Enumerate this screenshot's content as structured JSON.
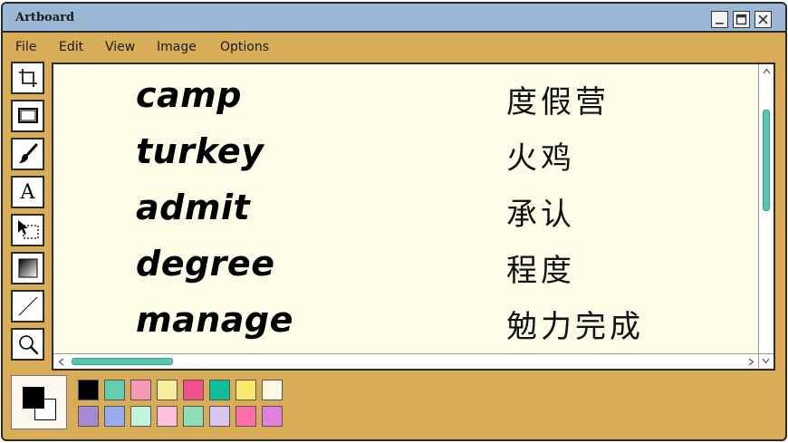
{
  "window": {
    "title": "Artboard"
  },
  "menu": [
    "File",
    "Edit",
    "View",
    "Image",
    "Options"
  ],
  "tools": [
    {
      "name": "crop",
      "icon": "crop-icon",
      "glyph": ""
    },
    {
      "name": "screen",
      "icon": "screen-icon",
      "glyph": ""
    },
    {
      "name": "brush",
      "icon": "brush-icon",
      "glyph": ""
    },
    {
      "name": "text",
      "icon": "text-icon",
      "glyph": "A"
    },
    {
      "name": "select",
      "icon": "select-icon",
      "glyph": ""
    },
    {
      "name": "gradient",
      "icon": "gradient-icon",
      "glyph": ""
    },
    {
      "name": "line",
      "icon": "line-icon",
      "glyph": ""
    },
    {
      "name": "zoom",
      "icon": "magnifier-icon",
      "glyph": ""
    }
  ],
  "vocab": [
    {
      "word": "camp",
      "translation": "度假营"
    },
    {
      "word": "turkey",
      "translation": "火鸡"
    },
    {
      "word": "admit",
      "translation": "承认"
    },
    {
      "word": "degree",
      "translation": "程度"
    },
    {
      "word": "manage",
      "translation": "勉力完成"
    }
  ],
  "colors": {
    "foreground": "#000000",
    "background": "#ffffff",
    "palette": [
      "#000000",
      "#62cdb0",
      "#f59ab4",
      "#f6ee9c",
      "#f0508c",
      "#0fbf9a",
      "#f7e96a",
      "#fdf8e0",
      "#a78ad2",
      "#98acf0",
      "#bff5df",
      "#fcc0d8",
      "#8edcb8",
      "#d8c6ee",
      "#ff6fa6",
      "#e080e0"
    ]
  }
}
